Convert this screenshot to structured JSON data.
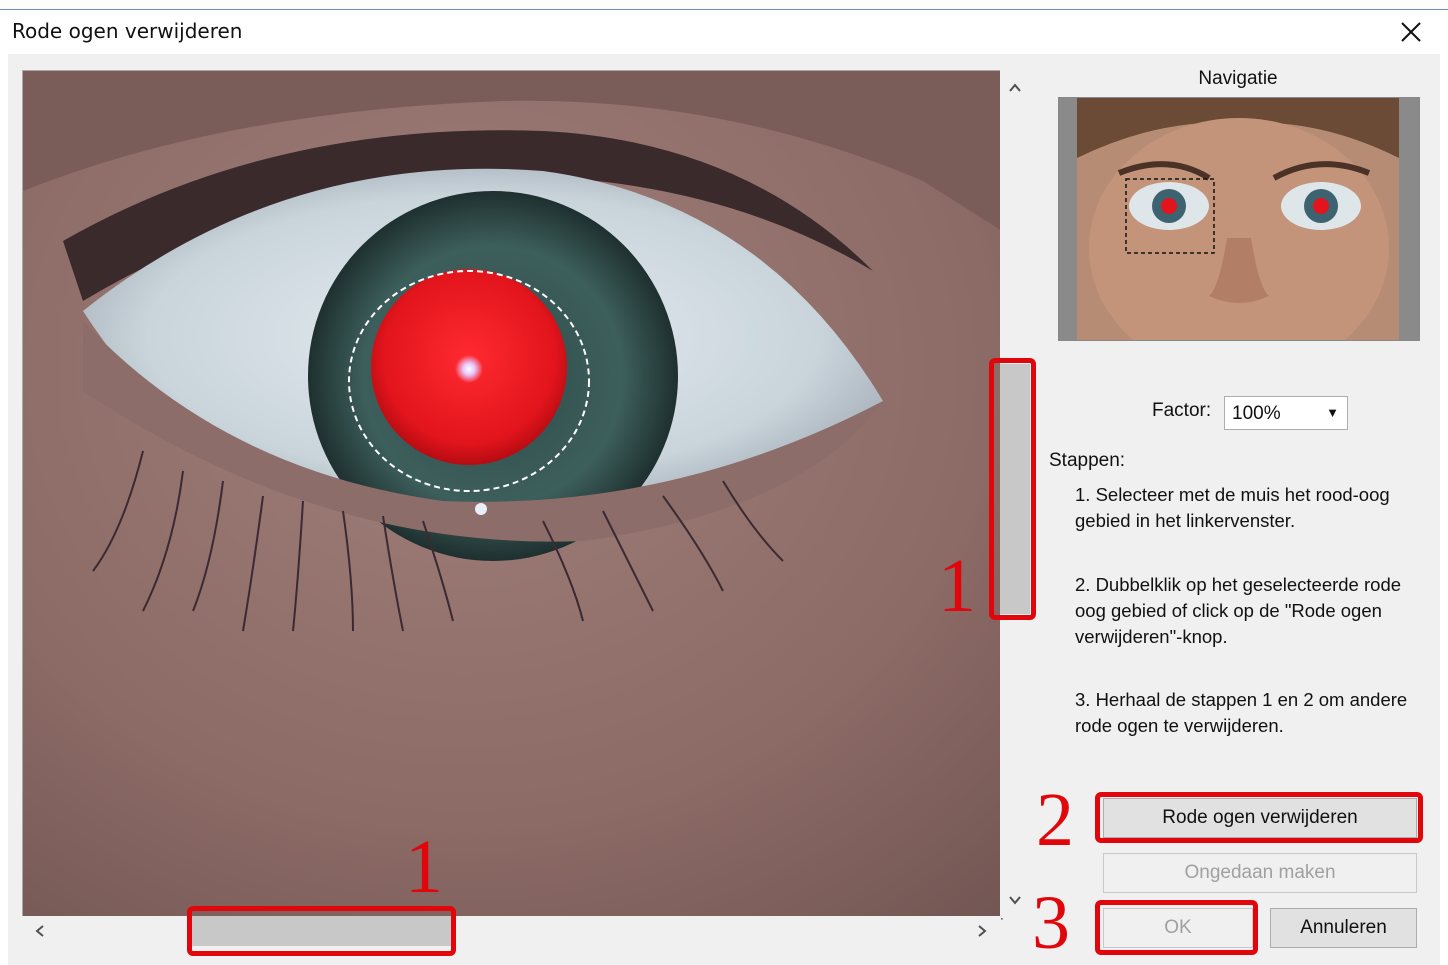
{
  "window": {
    "title": "Rode ogen verwijderen",
    "close_glyph": "✕"
  },
  "scrollbars": {
    "up_glyph": "⌃",
    "down_glyph": "⌄",
    "left_glyph": "‹",
    "right_glyph": "›"
  },
  "navigation": {
    "label": "Navigatie"
  },
  "factor": {
    "label": "Factor:",
    "selected": "100%",
    "arrow_glyph": "▼"
  },
  "steps": {
    "title": "Stappen:",
    "items": [
      "1. Selecteer met de muis het rood-oog gebied in het linkervenster.",
      "2. Dubbelklik op het geselecteerde rode oog gebied of click op de \"Rode ogen verwijderen\"-knop.",
      "3. Herhaal de stappen 1 en 2 om andere rode ogen te verwijderen."
    ]
  },
  "buttons": {
    "remove": "Rode ogen verwijderen",
    "undo": "Ongedaan maken",
    "ok": "OK",
    "cancel": "Annuleren"
  },
  "annotations": {
    "scroll_vertical": "1",
    "scroll_horizontal": "1",
    "remove_button": "2",
    "ok_button": "3"
  },
  "colors": {
    "annotation_red": "#e0060b",
    "red_eye": "#e2141c"
  }
}
